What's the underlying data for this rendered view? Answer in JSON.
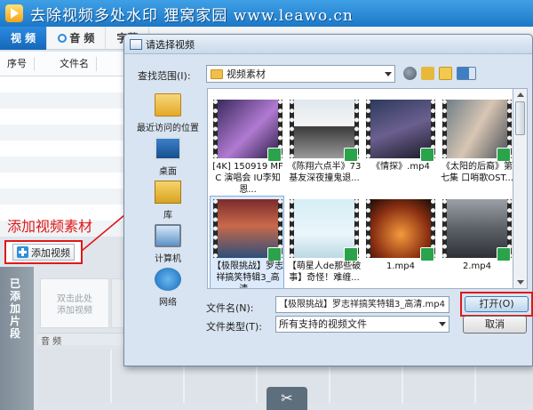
{
  "app": {
    "title": "去除视频多处水印 狸窝家园 www.leawo.cn"
  },
  "tabs": [
    {
      "label": "视 频",
      "active": true
    },
    {
      "label": "音 频",
      "active": false
    },
    {
      "label": "字幕",
      "active": false
    }
  ],
  "list_header": {
    "col_index": "序号",
    "col_filename": "文件名"
  },
  "annotation": {
    "text": "添加视频素材",
    "color": "#e01818"
  },
  "add_video_button": {
    "label": "添加视频"
  },
  "clip_panel": {
    "side_label": "已添加片段",
    "placeholder": "双击此处\n添加视频",
    "audio_label": "音 频"
  },
  "dialog": {
    "title": "请选择视频",
    "look_in_label": "查找范围(I):",
    "look_in_value": "视频素材",
    "places": [
      "最近访问的位置",
      "桌面",
      "库",
      "计算机",
      "网络"
    ],
    "files": [
      {
        "label": "[4K] 150919 MFC 演唱会 IU李知恩...",
        "selected": false
      },
      {
        "label": "《陈翔六点半》73 基友深夜撞鬼退...",
        "selected": false
      },
      {
        "label": "《情探》.mp4",
        "selected": false
      },
      {
        "label": "《太阳的后裔》第七集 口哨歌OST...",
        "selected": false
      },
      {
        "label": "【极限挑战】罗志祥搞笑特辑3_高清...",
        "selected": true
      },
      {
        "label": "【萌星人de那些破事】奇怪！难缠...",
        "selected": false
      },
      {
        "label": "1.mp4",
        "selected": false
      },
      {
        "label": "2.mp4",
        "selected": false
      }
    ],
    "filename_label": "文件名(N):",
    "filename_value": "【极限挑战】罗志祥搞笑特辑3_高清.mp4",
    "filetype_label": "文件类型(T):",
    "filetype_value": "所有支持的视频文件",
    "open_label": "打开(O)",
    "cancel_label": "取消"
  },
  "colors": {
    "highlight": "#e01818",
    "title_bar": "#1c78c8"
  }
}
